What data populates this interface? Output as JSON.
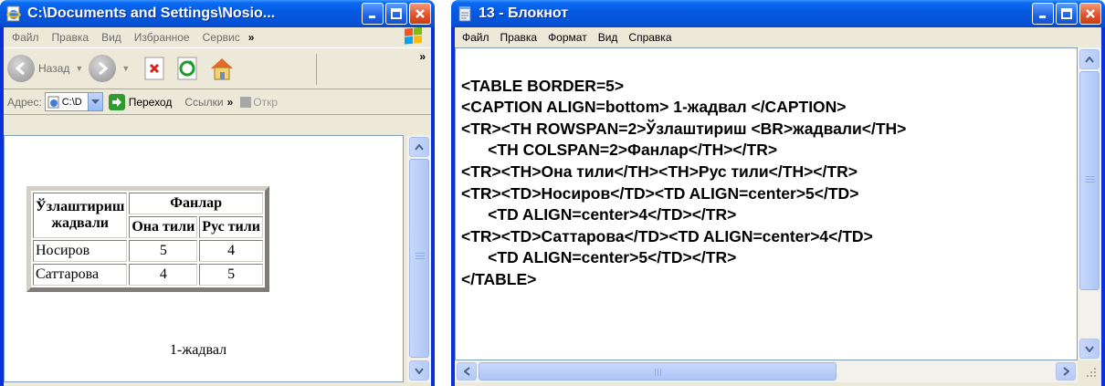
{
  "browser": {
    "title": "C:\\Documents and Settings\\Nosio...",
    "menu": [
      "Файл",
      "Правка",
      "Вид",
      "Избранное",
      "Сервис"
    ],
    "menu_chevron": "»",
    "toolbar": {
      "back_label": "Назад",
      "chevron": "»"
    },
    "address": {
      "label": "Адрес:",
      "value": "C:\\D",
      "go_label": "Переход",
      "links_label": "Ссылки",
      "links_chevron": "»",
      "open_label": "Откр"
    },
    "table": {
      "header_row1_col1": "Ўзлаштириш",
      "header_row1_col1_line2": "жадвали",
      "header_group": "Фанлар",
      "subheaders": [
        "Она тили",
        "Рус тили"
      ],
      "rows": [
        {
          "name": "Носиров",
          "v1": "5",
          "v2": "4"
        },
        {
          "name": "Саттарова",
          "v1": "4",
          "v2": "5"
        }
      ],
      "caption": "1-жадвал"
    }
  },
  "notepad": {
    "title": "13 - Блокнот",
    "menu": [
      "Файл",
      "Правка",
      "Формат",
      "Вид",
      "Справка"
    ],
    "lines": [
      "<TABLE BORDER=5>",
      "<CAPTION ALIGN=bottom> 1-жадвал </CAPTION>",
      "<TR><TH ROWSPAN=2>Ўзлаштириш <BR>жадвали</TH>",
      "      <TH COLSPAN=2>Фанлар</TH></TR>",
      "<TR><TH>Она тили</TH><TH>Рус тили</TH></TR>",
      "<TR><TD>Носиров</TD><TD ALIGN=center>5</TD>",
      "      <TD ALIGN=center>4</TD></TR>",
      "<TR><TD>Саттарова</TD><TD ALIGN=center>4</TD>",
      "      <TD ALIGN=center>5</TD></TR>",
      "</TABLE>"
    ]
  }
}
